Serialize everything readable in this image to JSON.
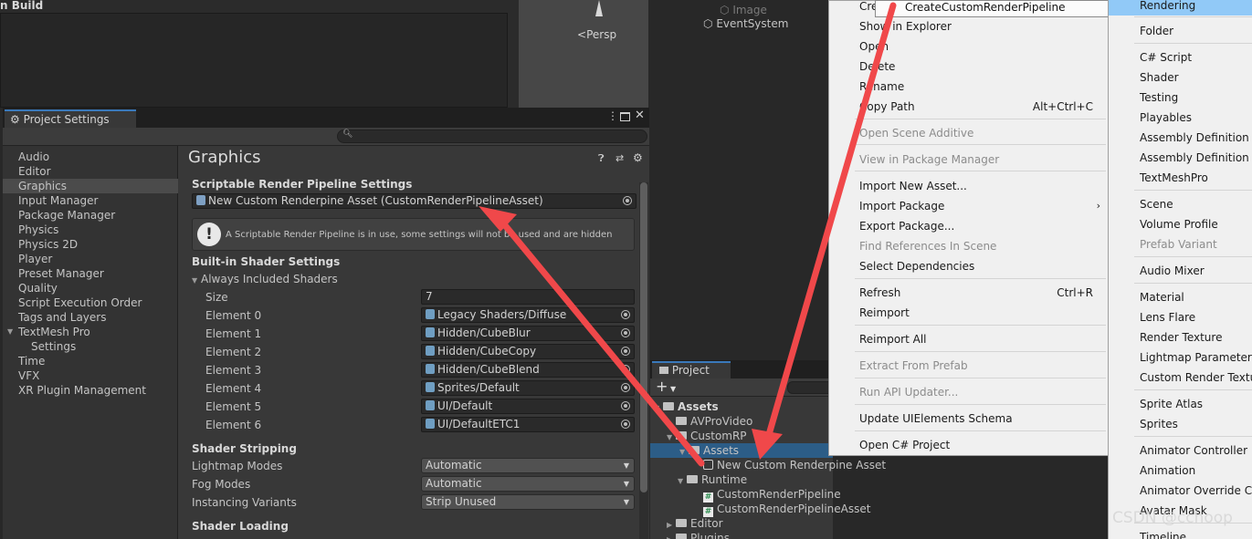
{
  "background": {
    "build_label": "n Build",
    "scene_persp": "Persp",
    "hierarchy_image": "Image",
    "hierarchy_event": "EventSystem"
  },
  "project_settings": {
    "tab_title": "Project Settings",
    "nav": [
      "Audio",
      "Editor",
      "Graphics",
      "Input Manager",
      "Package Manager",
      "Physics",
      "Physics 2D",
      "Player",
      "Preset Manager",
      "Quality",
      "Script Execution Order",
      "Tags and Layers",
      "TextMesh Pro",
      "Settings",
      "Time",
      "VFX",
      "XR Plugin Management"
    ],
    "selected_nav": "Graphics",
    "page_title": "Graphics",
    "srp_header": "Scriptable Render Pipeline Settings",
    "srp_asset": "New Custom Renderpine Asset (CustomRenderPipelineAsset)",
    "warning": "A Scriptable Render Pipeline is in use, some settings will not be used and are hidden",
    "builtin_header": "Built-in Shader Settings",
    "always_included": "Always Included Shaders",
    "size_label": "Size",
    "size_value": "7",
    "elements": [
      {
        "label": "Element 0",
        "value": "Legacy Shaders/Diffuse"
      },
      {
        "label": "Element 1",
        "value": "Hidden/CubeBlur"
      },
      {
        "label": "Element 2",
        "value": "Hidden/CubeCopy"
      },
      {
        "label": "Element 3",
        "value": "Hidden/CubeBlend"
      },
      {
        "label": "Element 4",
        "value": "Sprites/Default"
      },
      {
        "label": "Element 5",
        "value": "UI/Default"
      },
      {
        "label": "Element 6",
        "value": "UI/DefaultETC1"
      }
    ],
    "stripping_header": "Shader Stripping",
    "lightmap_label": "Lightmap Modes",
    "lightmap_value": "Automatic",
    "fog_label": "Fog Modes",
    "fog_value": "Automatic",
    "instancing_label": "Instancing Variants",
    "instancing_value": "Strip Unused",
    "loading_header": "Shader Loading"
  },
  "project_panel": {
    "tab_title": "Project",
    "add_label": "+",
    "tree": {
      "assets": "Assets",
      "avpro": "AVProVideo",
      "customrp": "CustomRP",
      "sub_assets": "Assets",
      "new_asset": "New Custom Renderpine Asset",
      "runtime": "Runtime",
      "script1": "CustomRenderPipeline",
      "script2": "CustomRenderPipelineAsset",
      "editor": "Editor",
      "plugins": "Plugins"
    }
  },
  "context_menu": {
    "tooltip": "CreateCustomRenderPipeline",
    "items": {
      "create": "Create",
      "show_in_explorer": "Show in Explorer",
      "open": "Open",
      "delete": "Delete",
      "rename": "Rename",
      "copy_path": "Copy Path",
      "copy_path_shortcut": "Alt+Ctrl+C",
      "open_scene_additive": "Open Scene Additive",
      "view_in_pm": "View in Package Manager",
      "import_new_asset": "Import New Asset...",
      "import_package": "Import Package",
      "export_package": "Export Package...",
      "find_references": "Find References In Scene",
      "select_dependencies": "Select Dependencies",
      "refresh": "Refresh",
      "refresh_shortcut": "Ctrl+R",
      "reimport": "Reimport",
      "reimport_all": "Reimport All",
      "extract_prefab": "Extract From Prefab",
      "run_api_updater": "Run API Updater...",
      "update_uie": "Update UIElements Schema",
      "open_cs_project": "Open C# Project"
    }
  },
  "create_submenu": {
    "items": [
      "Rendering",
      "Folder",
      "C# Script",
      "Shader",
      "Testing",
      "Playables",
      "Assembly Definition",
      "Assembly Definition Reference",
      "TextMeshPro",
      "Scene",
      "Volume Profile",
      "Prefab Variant",
      "Audio Mixer",
      "Material",
      "Lens Flare",
      "Render Texture",
      "Lightmap Parameters",
      "Custom Render Texture",
      "Sprite Atlas",
      "Sprites",
      "Animator Controller",
      "Animation",
      "Animator Override Controller",
      "Avatar Mask",
      "Timeline"
    ]
  },
  "watermark": "CSDN @cchoop",
  "colors": {
    "accent_blue": "#3a79bb",
    "selection": "#2c5d87",
    "menu_highlight": "#91c9f7",
    "arrow_red": "#f0484a"
  }
}
